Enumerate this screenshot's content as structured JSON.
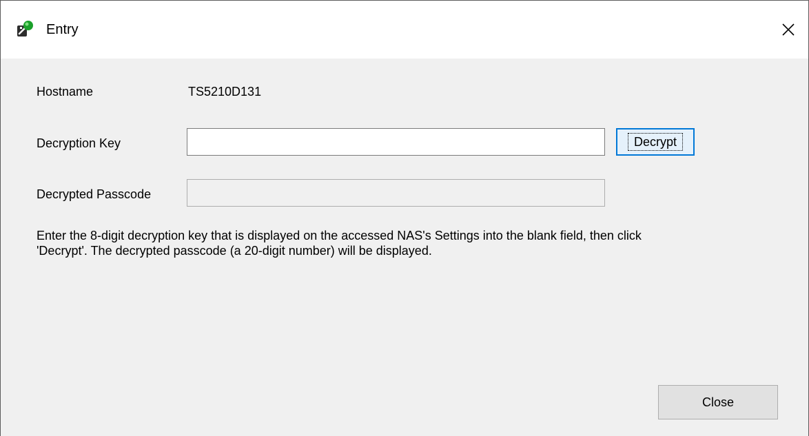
{
  "window": {
    "title": "Entry",
    "icon": "nas-app-icon",
    "close_icon": "close-icon"
  },
  "form": {
    "hostname_label": "Hostname",
    "hostname_value": "TS5210D131",
    "decryption_key_label": "Decryption Key",
    "decryption_key_value": "",
    "decrypt_button_label": "Decrypt",
    "decrypted_passcode_label": "Decrypted Passcode",
    "decrypted_passcode_value": ""
  },
  "instructions": {
    "line1": "Enter the 8-digit decryption key that is displayed on the accessed NAS's Settings into the blank field, then click",
    "line2": "'Decrypt'. The decrypted passcode (a 20-digit number) will be displayed."
  },
  "footer": {
    "close_button_label": "Close"
  },
  "colors": {
    "dialog_bg": "#f0f0f0",
    "titlebar_bg": "#ffffff",
    "focus_accent": "#0078d7",
    "button_bg": "#e1e1e1"
  }
}
